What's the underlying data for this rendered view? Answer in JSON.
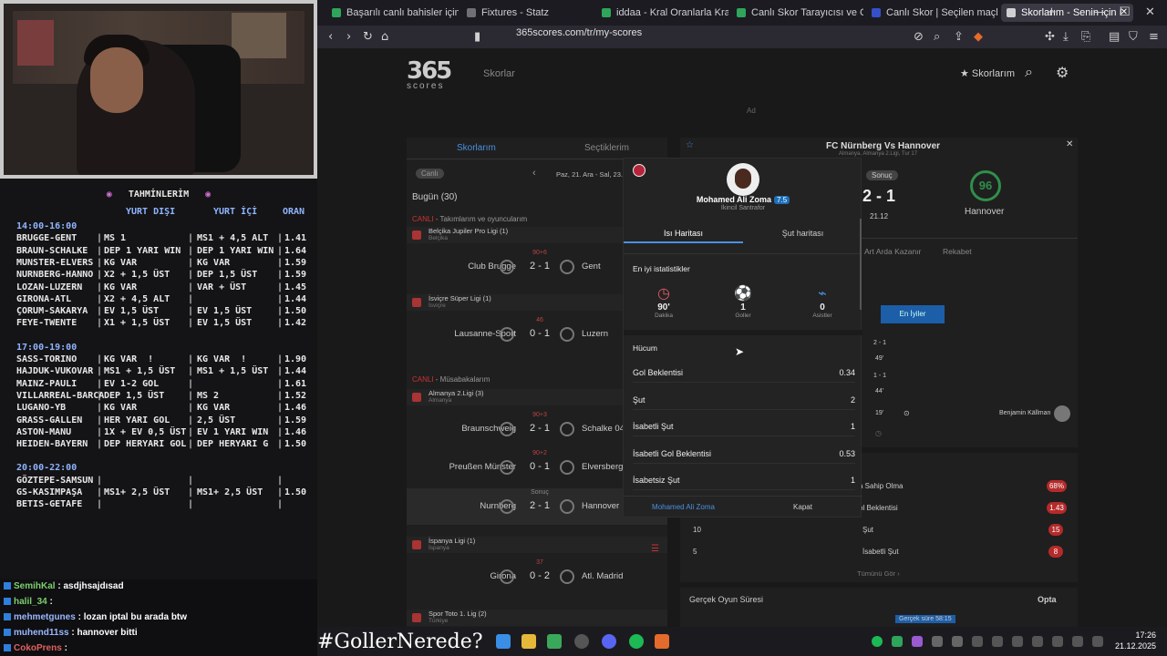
{
  "browser": {
    "tabs": [
      {
        "label": "Başarılı canlı bahisler için O",
        "color": "#2ea55a"
      },
      {
        "label": "Fixtures - Statz",
        "color": "#6f6f76"
      },
      {
        "label": "iddaa - Kral Oranlarla Kralla",
        "color": "#2ea55a"
      },
      {
        "label": "Canlı Skor Tarayıcısı ve Canl",
        "color": "#2ea55a"
      },
      {
        "label": "Canlı Skor | Seçilen maçlar",
        "color": "#3550c8"
      },
      {
        "label": "Skorlarım - Senin için İ",
        "color": "#d0d0d0"
      }
    ],
    "url": "365scores.com/tr/my-scores"
  },
  "site": {
    "brand": "365",
    "brand_sub": "scores",
    "nav_scores": "Skorlar",
    "my_scores": "Skorlarım",
    "ad": "Ad"
  },
  "left": {
    "tab_scores": "Skorlarım",
    "tab_selected": "Seçtiklerim",
    "live_chip": "Canlı",
    "date": "Paz, 21. Ara - Sal, 23.",
    "today": "Bugün (30)",
    "live_teams": "CANLI",
    "live_teams_text": " - Takımlarım ve oyuncularım",
    "live_comps": "CANLI",
    "live_comps_text": " - Müsabakalarım",
    "groups": [
      {
        "league": "Belçika Jupiler Pro Ligi (1)",
        "country": "Belçika",
        "status": "90+6",
        "home": "Club Brugge",
        "score": "2 - 1",
        "away": "Gent"
      },
      {
        "league": "İsviçre Süper Ligi (1)",
        "country": "İsviçre",
        "status": "46",
        "home": "Lausanne-Sport",
        "score": "0 - 1",
        "away": "Luzern"
      },
      {
        "league": "Almanya 2.Ligi (3)",
        "country": "Almanya",
        "status": "90+3",
        "home": "Braunschweig",
        "score": "2 - 1",
        "away": "Schalke 04"
      },
      {
        "league": "",
        "country": "",
        "status": "90+2",
        "home": "Preußen Münster",
        "score": "0 - 1",
        "away": "Elversberg"
      },
      {
        "league": "",
        "country": "",
        "status": "Sonuç",
        "home": "Nurnberg",
        "score": "2 - 1",
        "away": "Hannover"
      },
      {
        "league": "İspanya Ligi (1)",
        "country": "İspanya",
        "status": "37",
        "home": "Girona",
        "score": "0 - 2",
        "away": "Atl. Madrid"
      },
      {
        "league": "Spor Toto 1. Lig (2)",
        "country": "Türkiye",
        "status": "",
        "home": "",
        "score": "",
        "away": ""
      }
    ]
  },
  "match": {
    "title": "FC Nürnberg Vs Hannover",
    "subtitle": "Almanya, Almanya 2.Ligi, Tur 17",
    "status": "Sonuç",
    "score": "2 - 1",
    "date": "21.12",
    "away_team": "Hannover",
    "tabs": [
      "Art Arda Kazanır",
      "Rekabet"
    ],
    "best_btn": "En İyiler",
    "events": [
      {
        "score": "2 - 1",
        "minute": "49'"
      },
      {
        "score": "1 - 1",
        "minute": "44'"
      },
      {
        "score": "",
        "minute": "19'",
        "player": "Benjamin Källman"
      }
    ],
    "stats": [
      {
        "left": "",
        "label": "a Sahip Olma",
        "right": "68%"
      },
      {
        "left": "",
        "label": "ol Beklentisi",
        "right": "1.43"
      },
      {
        "left": "10",
        "label": "Şut",
        "right": "15"
      },
      {
        "left": "5",
        "label": "İsabetli Şut",
        "right": "8"
      }
    ],
    "all_stats": "Tümünü Gör",
    "real_time": "Gerçek Oyun Süresi",
    "real_time_val": "Gerçek süre 58:15",
    "opta": "Opta"
  },
  "popup": {
    "player": "Mohamed Ali Zoma",
    "rating": "7.5",
    "position": "İkincil Santrafor",
    "tab_heat": "Isı Haritası",
    "tab_shot": "Şut haritası",
    "best_stats": "En iyi istatistikler",
    "stats": [
      {
        "value": "90'",
        "label": "Dakika"
      },
      {
        "value": "1",
        "label": "Goller"
      },
      {
        "value": "0",
        "label": "Asistler"
      }
    ],
    "section": "Hücum",
    "rows": [
      {
        "label": "Gol Beklentisi",
        "value": "0.34"
      },
      {
        "label": "Şut",
        "value": "2"
      },
      {
        "label": "İsabetli Şut",
        "value": "1"
      },
      {
        "label": "İsabetli Gol Beklentisi",
        "value": "0.53"
      },
      {
        "label": "İsabetsiz Şut",
        "value": "1"
      }
    ],
    "footer_player": "Mohamed Ali Zoma",
    "footer_close": "Kapat"
  },
  "bets": {
    "title": "TAHMİNLERİM",
    "headers": [
      "",
      "YURT DIŞI",
      "YURT İÇİ",
      "ORAN"
    ],
    "slots": [
      {
        "time": "14:00-16:00",
        "rows": [
          [
            "BRUGGE-GENT",
            "MS 1",
            "MS1 + 4,5 ALT",
            "1.41"
          ],
          [
            "BRAUN-SCHALKE",
            "DEP 1 YARI WIN",
            "DEP 1 YARI WIN",
            "1.64"
          ],
          [
            "MUNSTER-ELVERS",
            "KG VAR",
            "KG VAR",
            "1.59"
          ],
          [
            "NURNBERG-HANNO",
            "X2 + 1,5 ÜST",
            "DEP 1,5 ÜST",
            "1.59"
          ],
          [
            "LOZAN-LUZERN",
            "KG VAR",
            "VAR + ÜST",
            "1.45"
          ],
          [
            "GIRONA-ATL",
            "X2 + 4,5 ALT",
            "",
            "1.44"
          ],
          [
            "ÇORUM-SAKARYA",
            "EV 1,5 ÜST",
            "EV 1,5 ÜST",
            "1.50"
          ],
          [
            "FEYE-TWENTE",
            "X1 + 1,5 ÜST",
            "EV 1,5 ÜST",
            "1.42"
          ]
        ]
      },
      {
        "time": "17:00-19:00",
        "rows": [
          [
            "SASS-TORINO",
            "KG VAR  !",
            "KG VAR  !",
            "1.90"
          ],
          [
            "HAJDUK-VUKOVAR",
            "MS1 + 1,5 ÜST",
            "MS1 + 1,5 ÜST",
            "1.44"
          ],
          [
            "MAINZ-PAULI",
            "EV 1-2 GOL",
            "",
            "1.61"
          ],
          [
            "VILLARREAL-BARCA",
            "DEP 1,5 ÜST",
            "MS 2",
            "1.52"
          ],
          [
            "LUGANO-YB",
            "KG VAR",
            "KG VAR",
            "1.46"
          ],
          [
            "GRASS-GALLEN",
            "HER YARI GOL",
            "2,5 ÜST",
            "1.59"
          ],
          [
            "ASTON-MANU",
            "1X + EV 0,5 ÜST",
            "EV 1 YARI WIN",
            "1.46"
          ],
          [
            "HEIDEN-BAYERN",
            "DEP HERYARI GOL",
            "DEP HERYARI G",
            "1.50"
          ]
        ]
      },
      {
        "time": "20:00-22:00",
        "rows": [
          [
            "GÖZTEPE-SAMSUN",
            "",
            "",
            ""
          ],
          [
            "GS-KASIMPAŞA",
            "MS1+ 2,5 ÜST",
            "MS1+ 2,5 ÜST",
            "1.50"
          ],
          [
            "BETIS-GETAFE",
            "",
            "",
            ""
          ]
        ]
      }
    ]
  },
  "chat": [
    {
      "user": "SemihKal",
      "msg": "asdjhsajdısad",
      "cls": "u"
    },
    {
      "user": "halil_34",
      "msg": "",
      "cls": "u"
    },
    {
      "user": "mehmetgunes",
      "msg": "lozan iptal bu arada btw",
      "cls": "u2"
    },
    {
      "user": "muhend11ss",
      "msg": "hannover bitti",
      "cls": "u2"
    },
    {
      "user": "CokoPrens",
      "msg": "",
      "cls": "u3"
    }
  ],
  "taskbar": {
    "hashtag": "#GollerNerede?",
    "time": "17:26",
    "date": "21.12.2025"
  }
}
